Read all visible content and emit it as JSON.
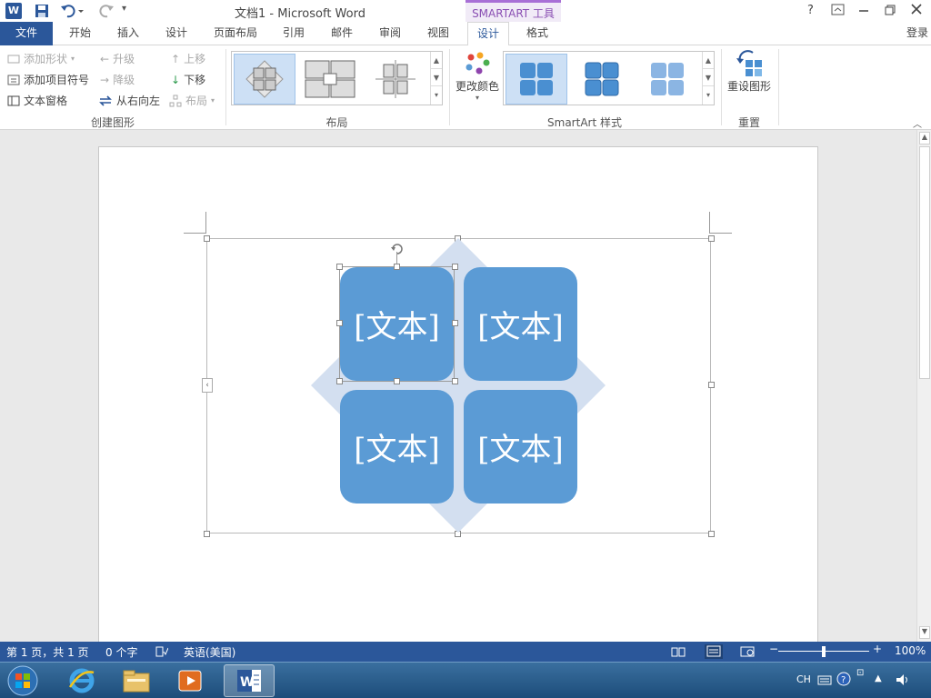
{
  "window": {
    "title": "文档1 - Microsoft Word",
    "context_tab_label": "SMARTART 工具",
    "help": "?",
    "login": "登录"
  },
  "tabs": {
    "file": "文件",
    "home": "开始",
    "insert": "插入",
    "design": "设计",
    "page_layout": "页面布局",
    "references": "引用",
    "mailings": "邮件",
    "review": "审阅",
    "view": "视图",
    "sa_design": "设计",
    "sa_format": "格式"
  },
  "ribbon": {
    "create_graphic": {
      "add_shape": "添加形状",
      "add_bullet": "添加项目符号",
      "text_pane": "文本窗格",
      "promote": "升级",
      "demote": "降级",
      "right_to_left": "从右向左",
      "move_up": "上移",
      "move_down": "下移",
      "layout": "布局",
      "group_label": "创建图形"
    },
    "layouts": {
      "group_label": "布局"
    },
    "styles": {
      "change_colors": "更改颜色",
      "group_label": "SmartArt 样式"
    },
    "reset": {
      "reset_graphic": "重设图形",
      "group_label": "重置"
    }
  },
  "smartart": {
    "boxes": [
      "[文本]",
      "[文本]",
      "[文本]",
      "[文本]"
    ],
    "box_color": "#5b9bd5",
    "diamond_color": "#d3dff0"
  },
  "status": {
    "page": "第 1 页，共 1 页",
    "words": "0 个字",
    "language": "英语(美国)",
    "zoom": "100%"
  },
  "taskbar": {
    "ime": "CH"
  },
  "colors": {
    "accent": "#2b579a",
    "context_accent": "#a86fd6"
  }
}
